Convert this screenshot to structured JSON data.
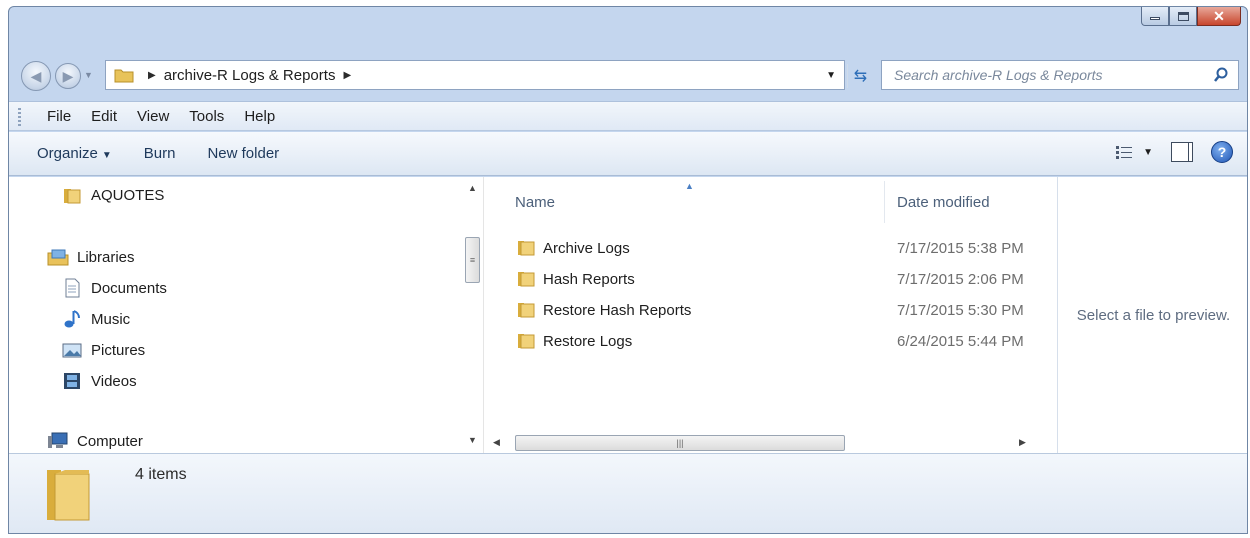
{
  "address": {
    "path": [
      "archive-R Logs & Reports"
    ],
    "search_placeholder": "Search archive-R Logs & Reports"
  },
  "menu": [
    "File",
    "Edit",
    "View",
    "Tools",
    "Help"
  ],
  "commands": {
    "organize": "Organize",
    "burn": "Burn",
    "new_folder": "New folder"
  },
  "nav": {
    "aquotes": "AQUOTES",
    "libraries": "Libraries",
    "documents": "Documents",
    "music": "Music",
    "pictures": "Pictures",
    "videos": "Videos",
    "computer": "Computer"
  },
  "columns": {
    "name": "Name",
    "date_modified": "Date modified"
  },
  "files": [
    {
      "name": "Archive Logs",
      "date": "7/17/2015 5:38 PM"
    },
    {
      "name": "Hash Reports",
      "date": "7/17/2015 2:06 PM"
    },
    {
      "name": "Restore Hash Reports",
      "date": "7/17/2015 5:30 PM"
    },
    {
      "name": "Restore Logs",
      "date": "6/24/2015 5:44 PM"
    }
  ],
  "preview_text": "Select a file to preview.",
  "status": {
    "item_count": "4 items"
  },
  "colors": {
    "frame": "#c4d6ee",
    "folder": "#e8c35a",
    "close_button": "#c8462d"
  }
}
